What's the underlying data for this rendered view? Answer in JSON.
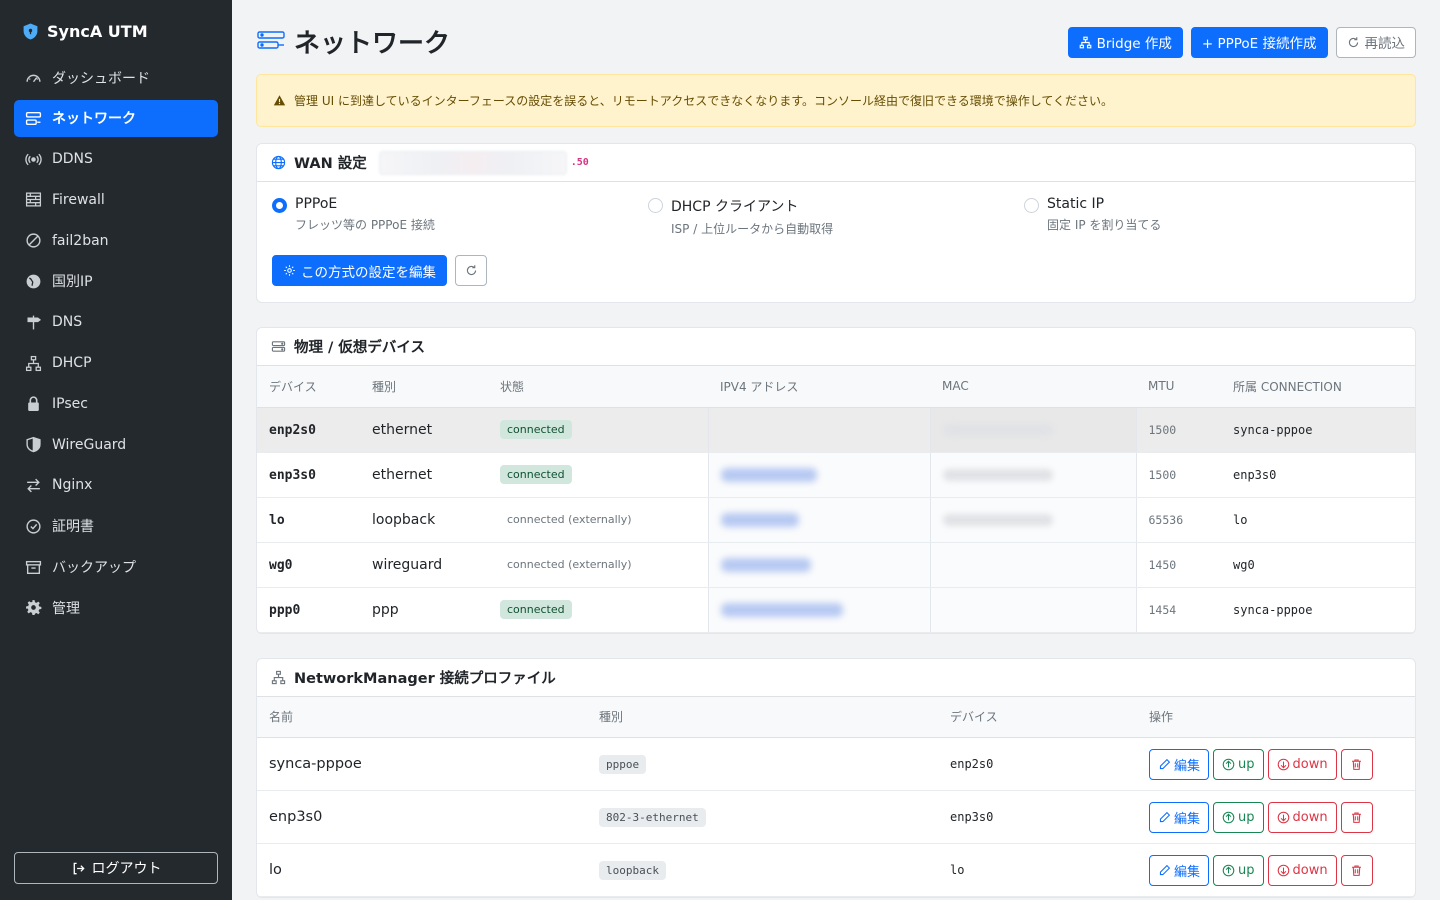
{
  "brand": {
    "name": "SyncA UTM"
  },
  "sidebar": {
    "items": [
      {
        "label": "ダッシュボード",
        "icon": "dashboard-icon"
      },
      {
        "label": "ネットワーク",
        "icon": "network-icon",
        "active": true
      },
      {
        "label": "DDNS",
        "icon": "broadcast-icon"
      },
      {
        "label": "Firewall",
        "icon": "firewall-icon"
      },
      {
        "label": "fail2ban",
        "icon": "ban-icon"
      },
      {
        "label": "国別IP",
        "icon": "globe-icon"
      },
      {
        "label": "DNS",
        "icon": "signpost-icon"
      },
      {
        "label": "DHCP",
        "icon": "diagram-icon"
      },
      {
        "label": "IPsec",
        "icon": "lock-icon"
      },
      {
        "label": "WireGuard",
        "icon": "shield-icon"
      },
      {
        "label": "Nginx",
        "icon": "arrows-icon"
      },
      {
        "label": "証明書",
        "icon": "certificate-icon"
      },
      {
        "label": "バックアップ",
        "icon": "archive-icon"
      },
      {
        "label": "管理",
        "icon": "gear-icon"
      }
    ],
    "logout": "ログアウト"
  },
  "header": {
    "title": "ネットワーク",
    "bridge_btn": "Bridge 作成",
    "pppoe_btn": "+ PPPoE 接続作成",
    "reload_btn": "再読込"
  },
  "alert": {
    "text": "管理 UI に到達しているインターフェースの設定を誤ると、リモートアクセスできなくなります。コンソール経由で復旧できる環境で操作してください。"
  },
  "wan": {
    "title": "WAN 設定",
    "ip_suffix": ".50",
    "options": [
      {
        "title": "PPPoE",
        "desc": "フレッツ等の PPPoE 接続",
        "checked": true
      },
      {
        "title": "DHCP クライアント",
        "desc": "ISP / 上位ルータから自動取得",
        "checked": false
      },
      {
        "title": "Static IP",
        "desc": "固定 IP を割り当てる",
        "checked": false
      }
    ],
    "edit_btn": "この方式の設定を編集"
  },
  "devices": {
    "title": "物理 / 仮想デバイス",
    "columns": [
      "デバイス",
      "種別",
      "状態",
      "IPV4 アドレス",
      "MAC",
      "MTU",
      "所属 CONNECTION"
    ],
    "rows": [
      {
        "device": "enp2s0",
        "type": "ethernet",
        "state": "connected",
        "state_style": "green",
        "mtu": "1500",
        "connection": "synca-pppoe"
      },
      {
        "device": "enp3s0",
        "type": "ethernet",
        "state": "connected",
        "state_style": "green",
        "mtu": "1500",
        "connection": "enp3s0"
      },
      {
        "device": "lo",
        "type": "loopback",
        "state": "connected (externally)",
        "state_style": "plain",
        "mtu": "65536",
        "connection": "lo"
      },
      {
        "device": "wg0",
        "type": "wireguard",
        "state": "connected (externally)",
        "state_style": "plain",
        "mtu": "1450",
        "connection": "wg0"
      },
      {
        "device": "ppp0",
        "type": "ppp",
        "state": "connected",
        "state_style": "green",
        "mtu": "1454",
        "connection": "synca-pppoe"
      }
    ]
  },
  "profiles": {
    "title": "NetworkManager 接続プロファイル",
    "columns": [
      "名前",
      "種別",
      "デバイス",
      "操作"
    ],
    "rows": [
      {
        "name": "synca-pppoe",
        "type": "pppoe",
        "device": "enp2s0"
      },
      {
        "name": "enp3s0",
        "type": "802-3-ethernet",
        "device": "enp3s0"
      },
      {
        "name": "lo",
        "type": "loopback",
        "device": "lo"
      }
    ],
    "ops": {
      "edit": "編集",
      "up": "up",
      "down": "down"
    }
  }
}
